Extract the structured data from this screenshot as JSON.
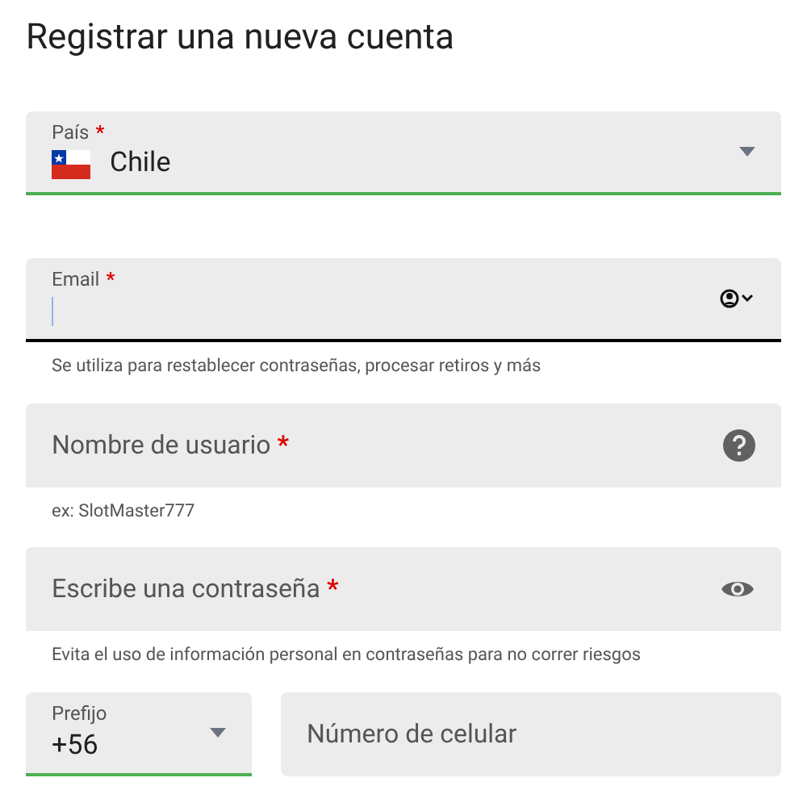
{
  "title": "Registrar una nueva cuenta",
  "fields": [
    {
      "kind": "select",
      "label": "País",
      "required": "*",
      "value": "Chile",
      "flag": true,
      "valid": true,
      "focused": false
    },
    {
      "kind": "input",
      "label": "Email",
      "required": "*",
      "valid": false,
      "focused": true,
      "helper": "Se utiliza para restablecer contraseñas, procesar retiros y más"
    },
    {
      "kind": "placeholder",
      "label": "Nombre de usuario",
      "required": "*",
      "valid": false,
      "focused": false,
      "helper": "ex: SlotMaster777"
    },
    {
      "kind": "placeholder",
      "label": "Escribe una contraseña",
      "required": "*",
      "valid": false,
      "focused": false,
      "helper": "Evita el uso de información personal en contraseñas para no correr riesgos"
    }
  ],
  "phone": {
    "prefix": {
      "label": "Prefijo",
      "value": "+56",
      "valid": true
    },
    "number": {
      "placeholder": "Número de celular"
    }
  }
}
